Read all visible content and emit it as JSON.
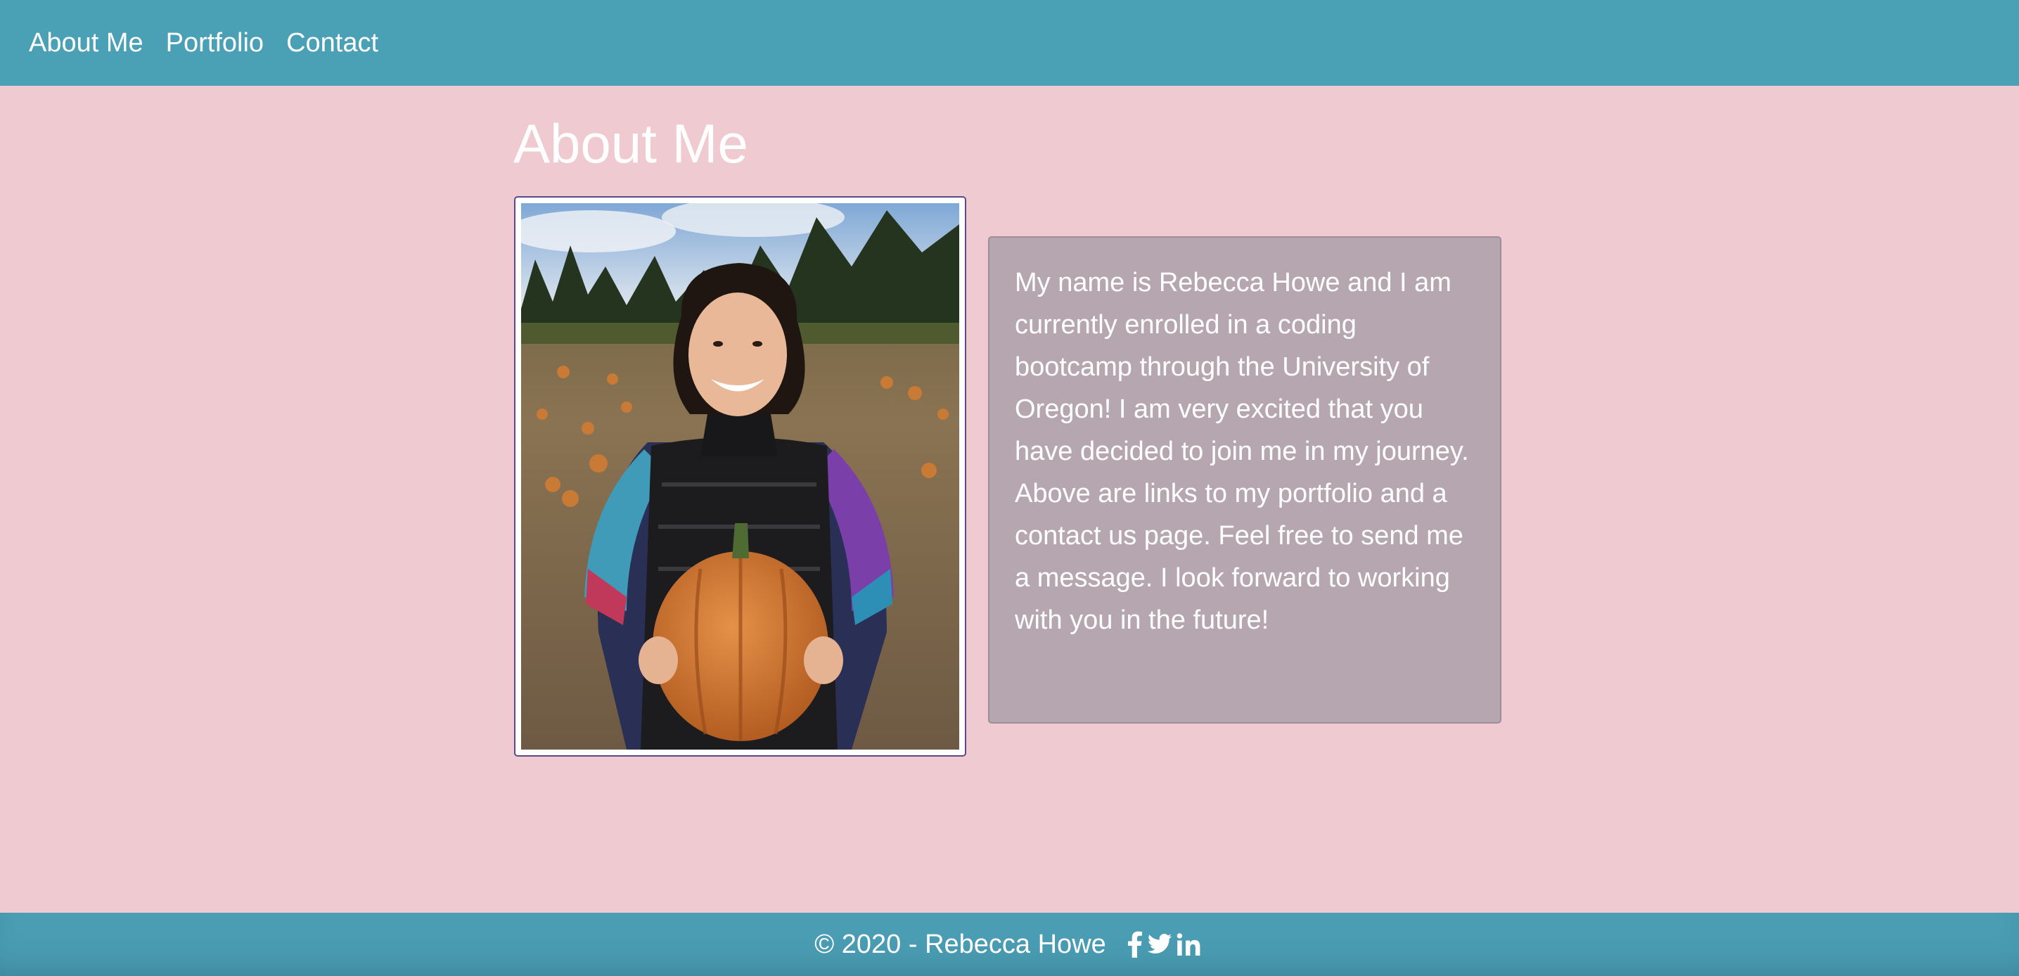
{
  "nav": {
    "items": [
      {
        "label": "About Me"
      },
      {
        "label": "Portfolio"
      },
      {
        "label": "Contact"
      }
    ]
  },
  "main": {
    "title": "About Me",
    "bio": "My name is Rebecca Howe and I am currently enrolled in a coding bootcamp through the University of Oregon! I am very excited that you have decided to join me in my journey. Above are links to my portfolio and a contact us page. Feel free to send me a message. I look forward to working with you in the future!"
  },
  "footer": {
    "copyright": "© 2020 - Rebecca Howe",
    "social": [
      "facebook-icon",
      "twitter-icon",
      "linkedin-icon"
    ]
  },
  "colors": {
    "navbar": "#4aa0b5",
    "background": "#efcad0",
    "card": "#b6a6b0",
    "text": "#ffffff"
  }
}
